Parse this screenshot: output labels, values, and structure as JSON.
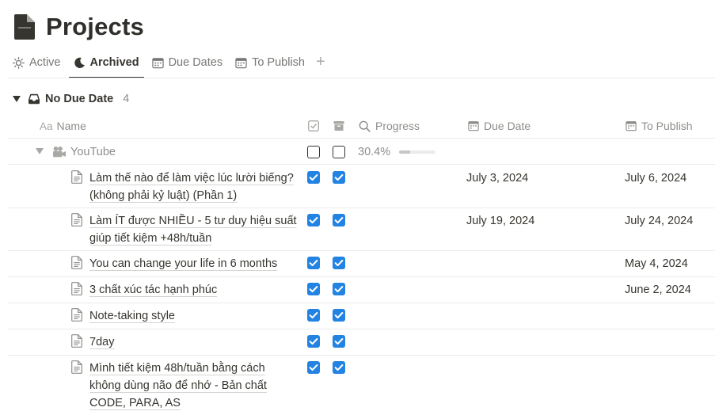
{
  "page": {
    "title": "Projects",
    "icon": "document-icon"
  },
  "tabs": [
    {
      "label": "Active",
      "icon": "sun-icon",
      "active": false
    },
    {
      "label": "Archived",
      "icon": "moon-icon",
      "active": true
    },
    {
      "label": "Due Dates",
      "icon": "calendar-icon",
      "active": false
    },
    {
      "label": "To Publish",
      "icon": "calendar-icon",
      "active": false
    }
  ],
  "tab_add": "+",
  "group": {
    "label": "No Due Date",
    "count": "4",
    "icon": "inbox-icon"
  },
  "columns": {
    "name_prefix": "Aa",
    "name": "Name",
    "progress": "Progress",
    "due_date": "Due Date",
    "to_publish": "To Publish"
  },
  "parent": {
    "name": "YouTube",
    "progress_text": "30.4%",
    "progress": 0.304,
    "icon": "video-camera-icon"
  },
  "rows": [
    {
      "name": "Làm thế nào để làm việc lúc lười biếng? (không phải kỷ luật) (Phần 1)",
      "due": "July 3, 2024",
      "publish": "July 6, 2024"
    },
    {
      "name": "Làm ÍT được NHIỀU - 5 tư duy hiệu suất giúp tiết kiệm +48h/tuần",
      "due": "July 19, 2024",
      "publish": "July 24, 2024"
    },
    {
      "name": "You can change your life in 6 months",
      "due": "",
      "publish": "May 4, 2024"
    },
    {
      "name": "3 chất xúc tác hạnh phúc",
      "due": "",
      "publish": "June 2, 2024"
    },
    {
      "name": "Note-taking style",
      "due": "",
      "publish": ""
    },
    {
      "name": "7day",
      "due": "",
      "publish": ""
    },
    {
      "name": "Mình tiết kiệm 48h/tuần bằng cách không dùng não để nhớ - Bản chất CODE, PARA, AS",
      "due": "",
      "publish": ""
    }
  ],
  "colors": {
    "accent": "#2383e2",
    "text": "#37352f",
    "muted": "#8e8d89"
  }
}
